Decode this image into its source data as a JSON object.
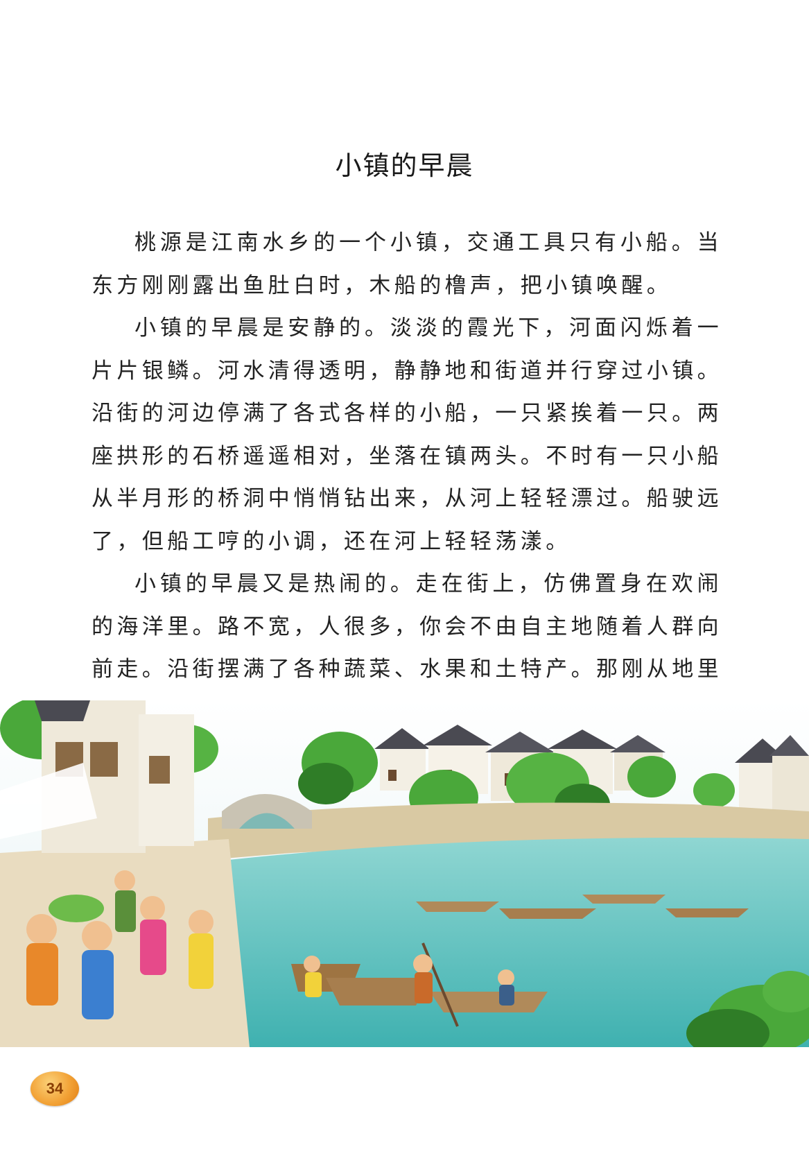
{
  "title": "小镇的早晨",
  "paragraphs": [
    "桃源是江南水乡的一个小镇，交通工具只有小船。当东方刚刚露出鱼肚白时，木船的橹声，把小镇唤醒。",
    "小镇的早晨是安静的。淡淡的霞光下，河面闪烁着一片片银鳞。河水清得透明，静静地和街道并行穿过小镇。沿街的河边停满了各式各样的小船，一只紧挨着一只。两座拱形的石桥遥遥相对，坐落在镇两头。不时有一只小船从半月形的桥洞中悄悄钻出来，从河上轻轻漂过。船驶远了，但船工哼的小调，还在河上轻轻荡漾。",
    "小镇的早晨又是热闹的。走在街上，仿佛置身在欢闹的海洋里。路不宽，人很多，你会不由自主地随着人群向前走。沿街摆满了各种蔬菜、水果和土特产。那刚从地里拔下来的小白菜、油菜，还带着晶莹的露珠，鲜嫩嫩的；那刚从"
  ],
  "illustration": {
    "description_icon": "water-town-illustration-icon",
    "colors": {
      "sky": "#e8f4f8",
      "river": "#5cc6c4",
      "river_dark": "#3aa9aa",
      "trees": "#4aa83a",
      "tree_dark": "#2f7d27",
      "roof": "#4a4a52",
      "wall": "#f3efe4",
      "bank": "#d9c9a3"
    }
  },
  "page_number": "34"
}
